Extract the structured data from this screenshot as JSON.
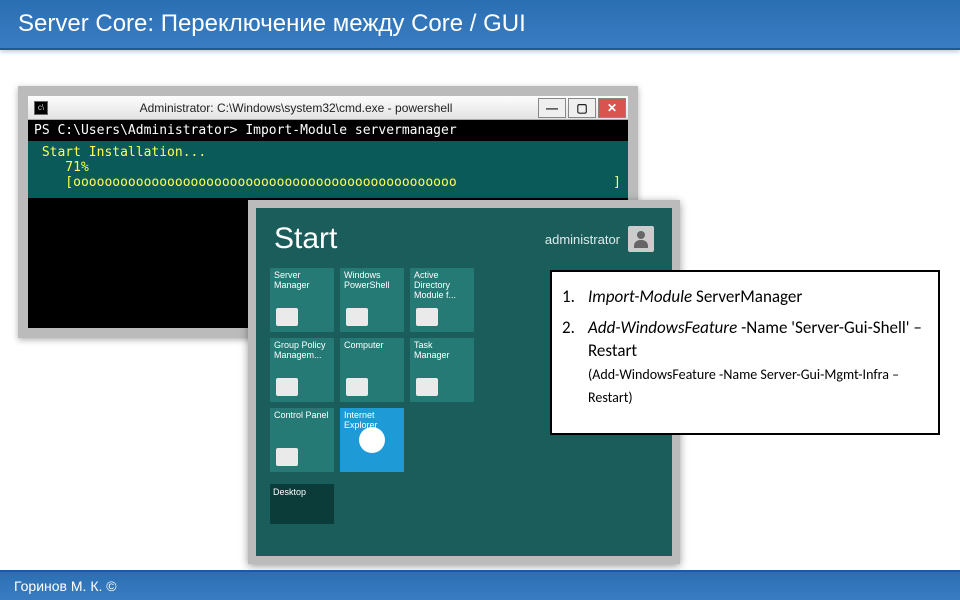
{
  "header": {
    "title": "Server Core: Переключение между Core / GUI"
  },
  "footer": {
    "author": "Горинов М. К. ©"
  },
  "cmd_window": {
    "title": "Administrator: C:\\Windows\\system32\\cmd.exe - powershell",
    "prompt_line": "PS C:\\Users\\Administrator> Import-Module servermanager",
    "progress_title": " Start Installation...",
    "progress_pct": "    71%",
    "progress_bar": "    [ooooooooooooooooooooooooooooooooooooooooooooooooo                    ]"
  },
  "start_screen": {
    "title": "Start",
    "user": "administrator",
    "tiles": [
      {
        "label": "Server Manager"
      },
      {
        "label": "Windows PowerShell"
      },
      {
        "label": "Active Directory Module f..."
      },
      {
        "label": "Group Policy Managem..."
      },
      {
        "label": "Computer"
      },
      {
        "label": "Task Manager"
      },
      {
        "label": "Control Panel"
      },
      {
        "label": "Internet Explorer",
        "selected": true
      }
    ],
    "desktop_label": "Desktop"
  },
  "commands": {
    "item1_cmd": "Import-Module",
    "item1_arg": " ServerManager",
    "item2_cmd": "Add-WindowsFeature",
    "item2_rest": " -Name 'Server-Gui-Shell' –Restart ",
    "item2_sub": "(Add-WindowsFeature -Name Server-Gui-Mgmt-Infra –Restart)"
  }
}
